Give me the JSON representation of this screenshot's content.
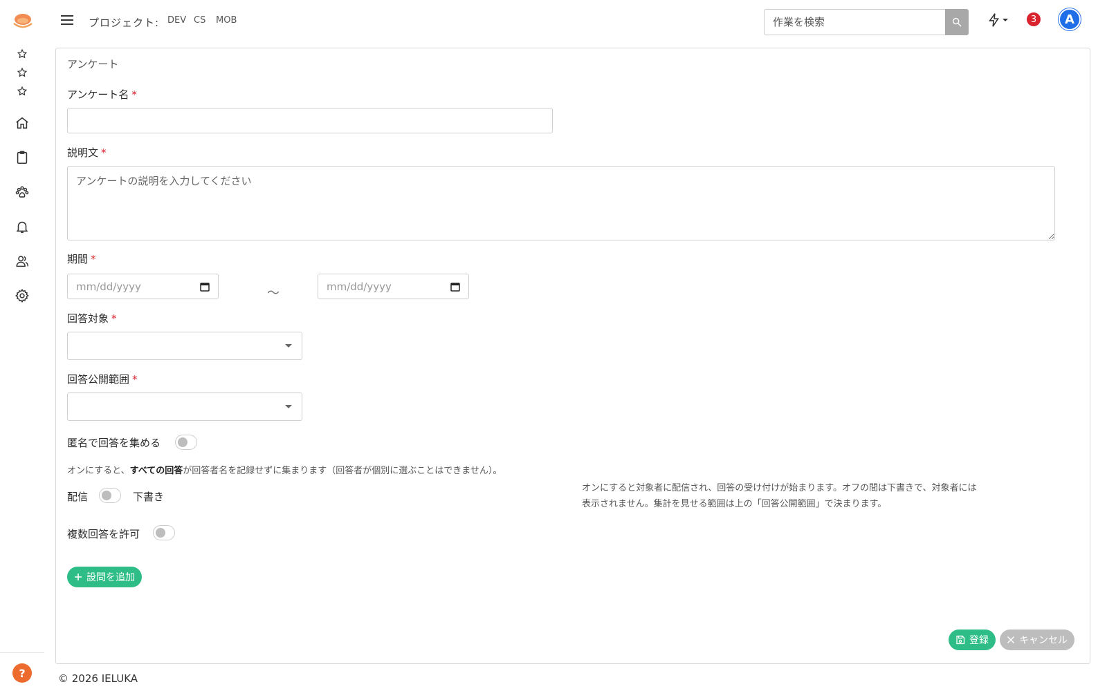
{
  "header": {
    "project_label": "プロジェクト:",
    "projects": [
      "DEV",
      "CS",
      "MOB"
    ],
    "search_placeholder": "作業を検索",
    "notification_count": "3",
    "avatar_initial": "A"
  },
  "sidebar": {
    "help_label": "?"
  },
  "form": {
    "card_title": "アンケート",
    "name_label": "アンケート名",
    "description_label": "説明文",
    "description_placeholder": "アンケートの説明を入力してください",
    "period_label": "期間",
    "date_placeholder": "mm/dd/yyyy",
    "tilde": "〜",
    "target_label": "回答対象",
    "visibility_label": "回答公開範囲",
    "required_mark": "*",
    "anonymous_label": "匿名で回答を集める",
    "anonymous_help_pre": "オンにすると、",
    "anonymous_help_bold": "すべての回答",
    "anonymous_help_post": "が回答者名を記録せずに集まります（回答者が個別に選ぶことはできません）。",
    "publish_label": "配信",
    "draft_label": "下書き",
    "publish_note_1": "オンにすると対象者に配信され、回答の受け付けが始まります。オフの間は下書きで、対象者には",
    "publish_note_2": "表示されません。集計を見せる範囲は上の「回答公開範囲」で決まります。",
    "multiple_label": "複数回答を許可",
    "add_question": "設問を追加",
    "save": "登録",
    "cancel": "キャンセル"
  },
  "footer": {
    "copyright": "© 2026 IELUKA"
  },
  "colors": {
    "accent_green": "#2ebd86",
    "required_red": "#d9232e",
    "avatar_blue": "#1f6ee8",
    "help_orange": "#ee6b2f"
  }
}
